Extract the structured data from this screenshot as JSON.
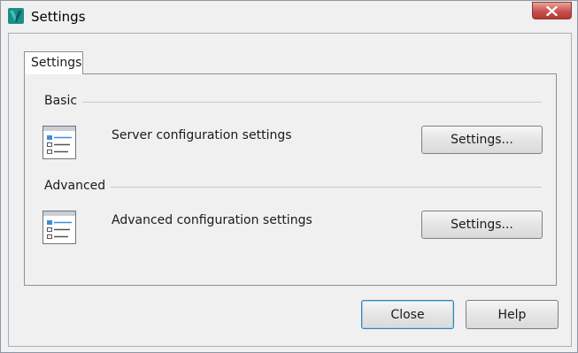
{
  "window": {
    "title": "Settings",
    "app_icon": "app-logo-icon",
    "close_icon": "close-icon"
  },
  "tabs": [
    {
      "label": "Settings",
      "selected": true
    }
  ],
  "groups": {
    "basic": {
      "label": "Basic",
      "description": "Server configuration settings",
      "button_label": "Settings...",
      "icon": "settings-list-icon"
    },
    "advanced": {
      "label": "Advanced",
      "description": "Advanced configuration settings",
      "button_label": "Settings...",
      "icon": "settings-list-icon"
    }
  },
  "footer": {
    "close_label": "Close",
    "help_label": "Help"
  },
  "colors": {
    "close_button": "#c75050",
    "default_button_border": "#3c7fb1",
    "window_background": "#f0f0f0"
  }
}
